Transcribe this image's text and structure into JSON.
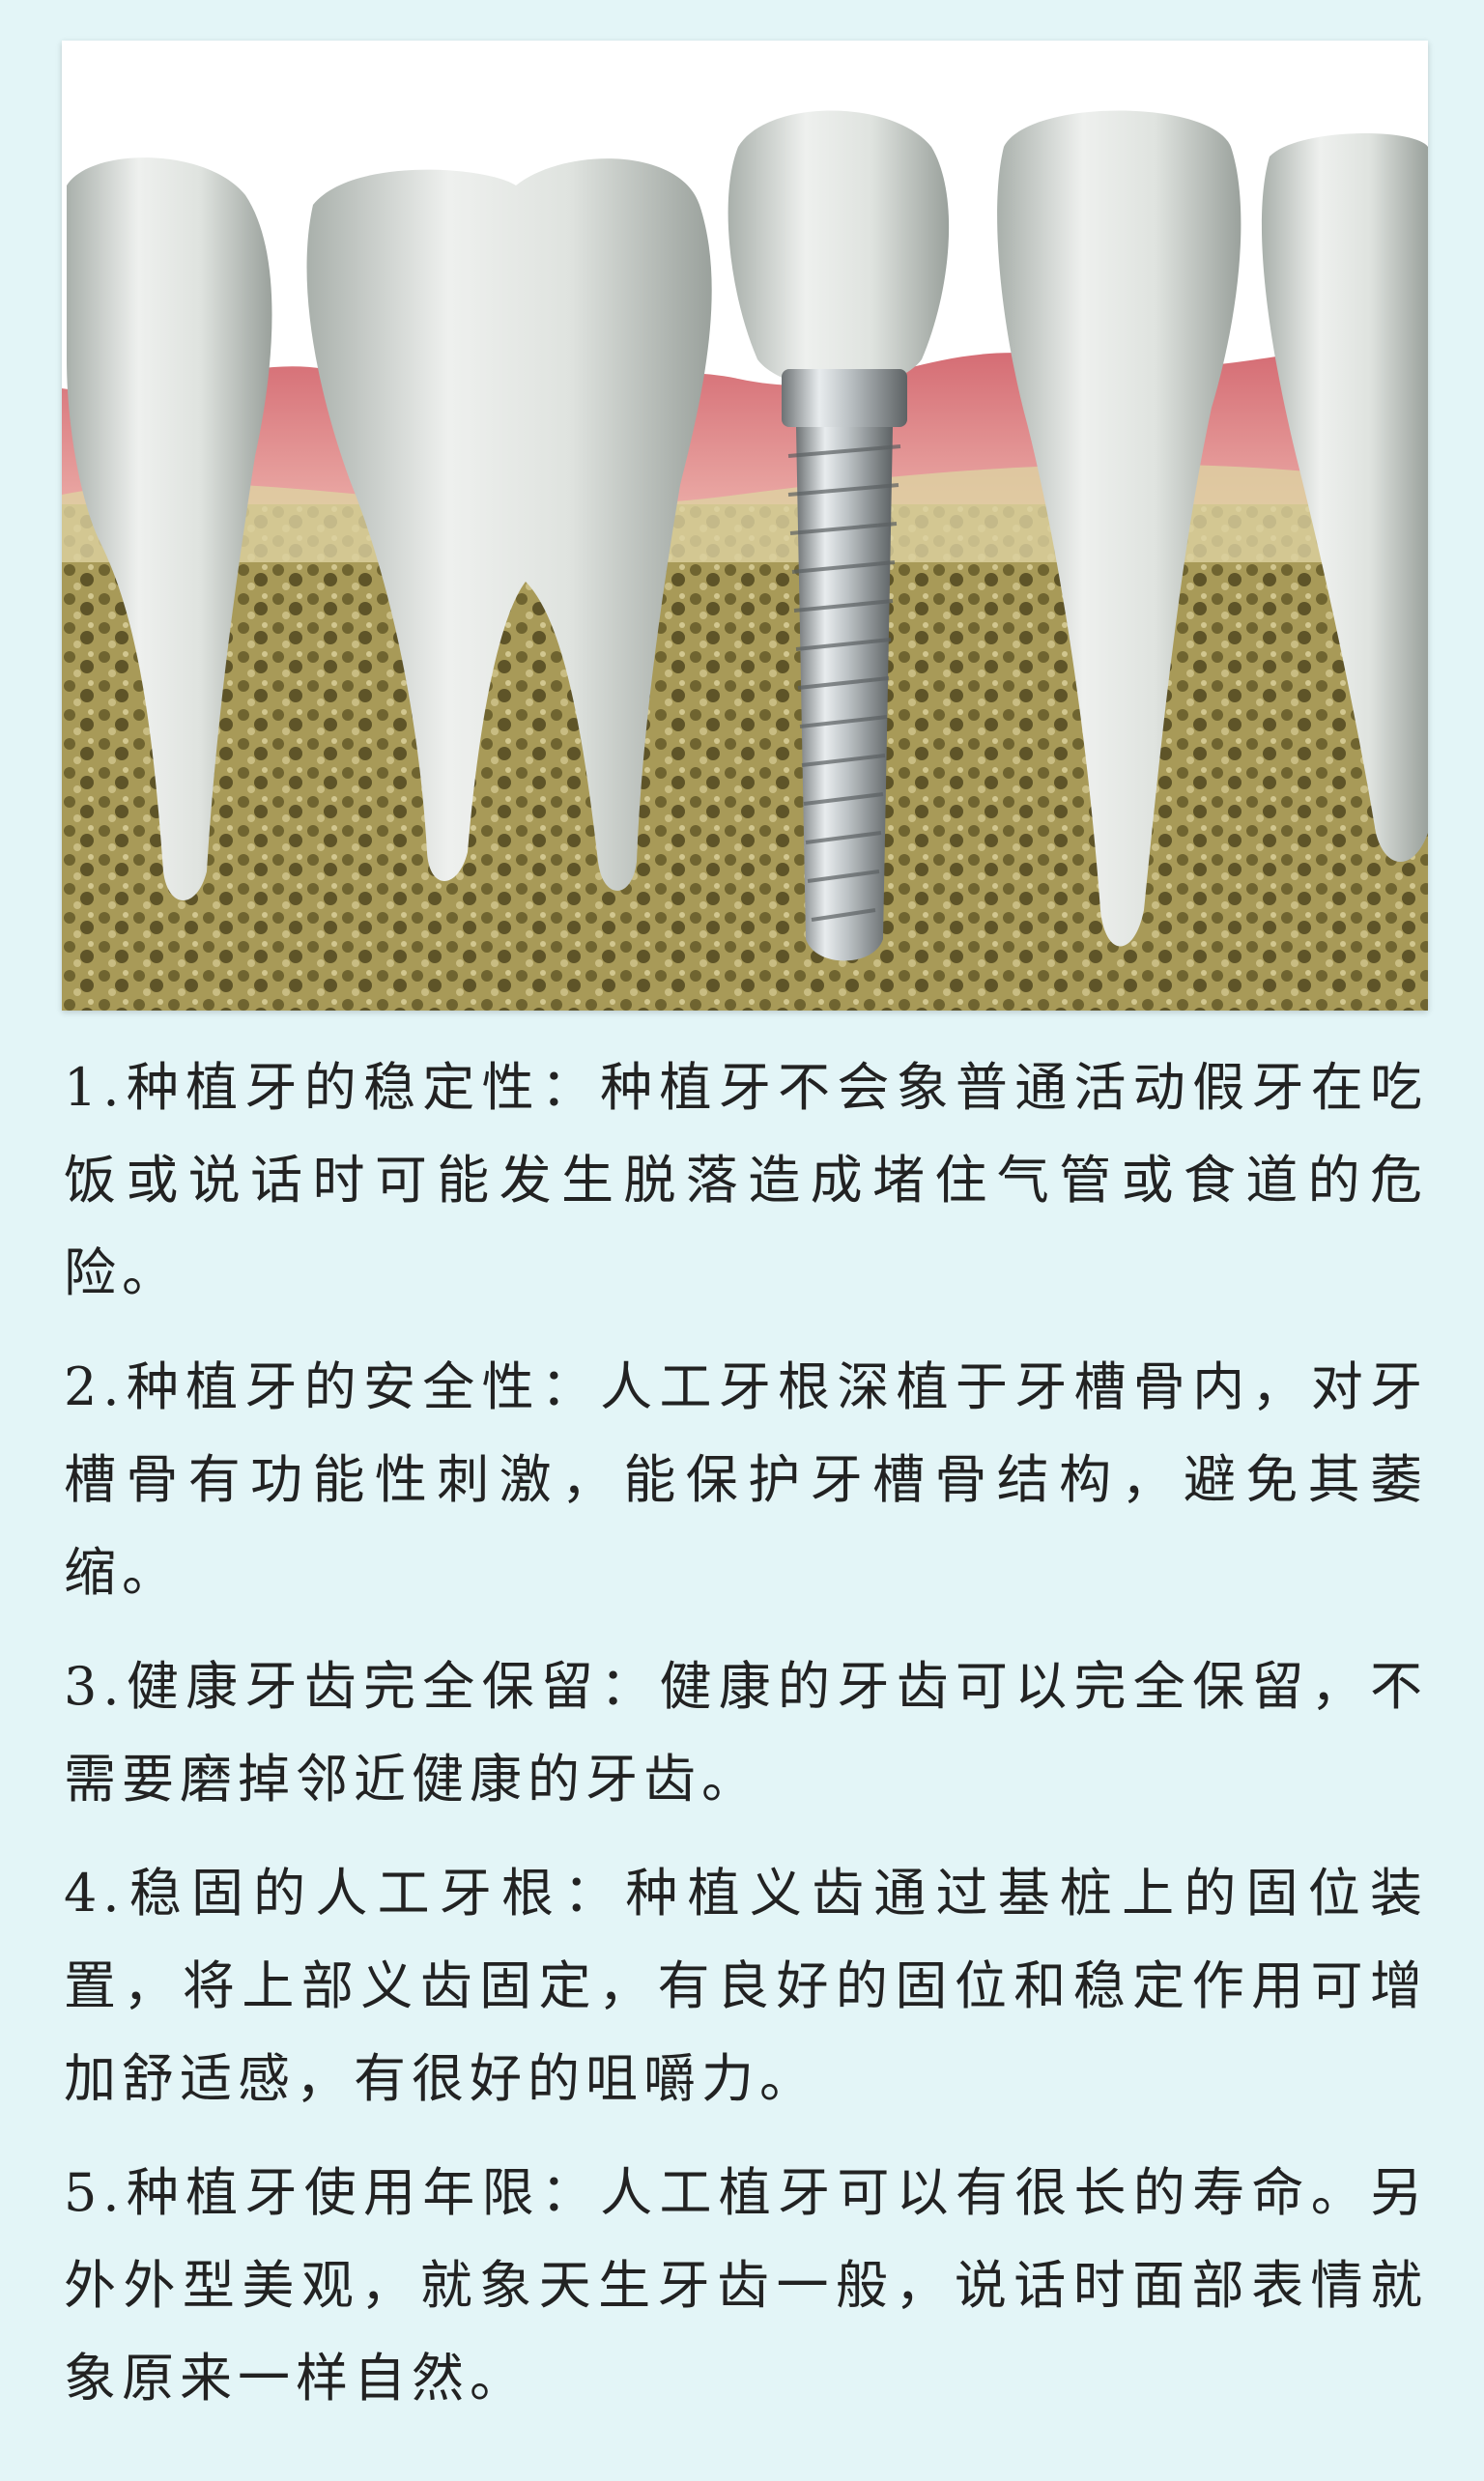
{
  "image": {
    "subject": "dental-implant-illustration"
  },
  "paragraphs": [
    "1.种植牙的稳定性：种植牙不会象普通活动假牙在吃饭或说话时可能发生脱落造成堵住气管或食道的危险。",
    "2.种植牙的安全性：人工牙根深植于牙槽骨内，对牙槽骨有功能性刺激，能保护牙槽骨结构，避免其萎缩。",
    "3.健康牙齿完全保留：健康的牙齿可以完全保留，不需要磨掉邻近健康的牙齿。",
    "4.稳固的人工牙根：种植义齿通过基桩上的固位装置，将上部义齿固定，有良好的固位和稳定作用可增加舒适感，有很好的咀嚼力。",
    "5.种植牙使用年限：人工植牙可以有很长的寿命。另外外型美观，就象天生牙齿一般，说话时面部表情就象原来一样自然。"
  ]
}
